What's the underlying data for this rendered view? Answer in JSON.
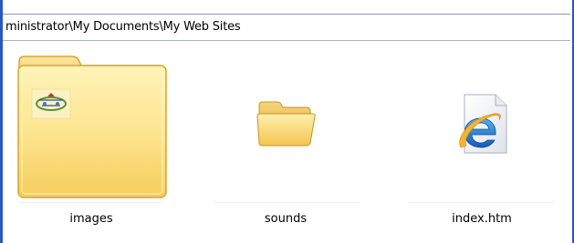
{
  "address": {
    "path": "ministrator\\My Documents\\My Web Sites"
  },
  "items": [
    {
      "label": "images",
      "icon": "folder-thumbnail-icon",
      "type": "folder"
    },
    {
      "label": "sounds",
      "icon": "folder-icon",
      "type": "folder"
    },
    {
      "label": "index.htm",
      "icon": "internet-explorer-icon",
      "type": "html-file"
    }
  ],
  "colors": {
    "frame": "#2a55c5",
    "folder_light": "#fde58f",
    "folder_dark": "#d9a52b",
    "ie_blue": "#1f6fd1"
  }
}
